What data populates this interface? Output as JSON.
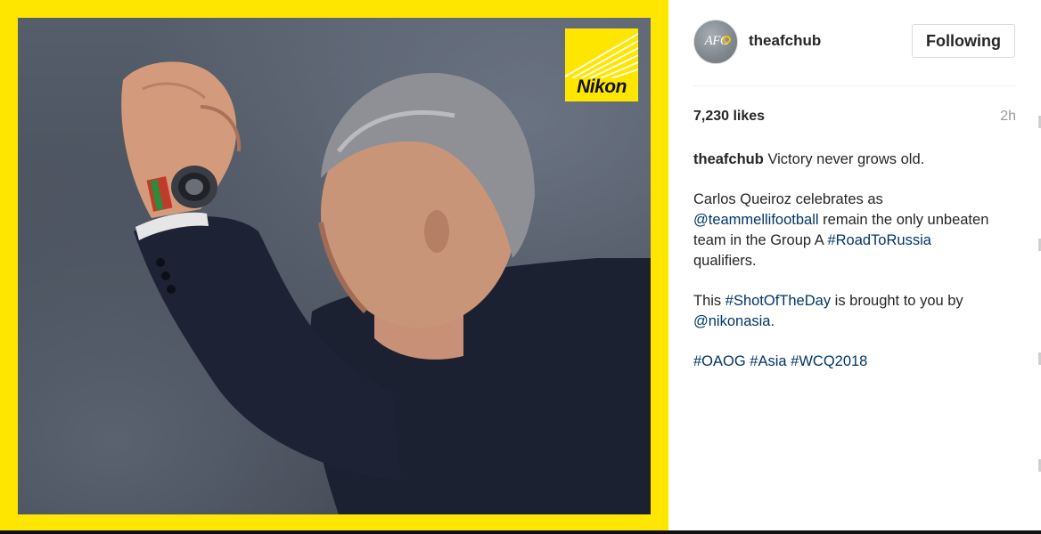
{
  "brand_logo": {
    "text": "Nikon"
  },
  "post": {
    "username": "theafchub",
    "avatar_text": "AFC",
    "follow_label": "Following",
    "likes": "7,230 likes",
    "time_ago": "2h"
  },
  "caption": {
    "username": "theafchub",
    "line1_text": "Victory never grows old.",
    "p2_a": "Carlos Queiroz celebrates as",
    "p2_mention": "@teammellifootball",
    "p2_b": "remain the only unbeaten team in the Group A",
    "p2_hashtag": "#RoadToRussia",
    "p2_c": "qualifiers.",
    "p3_a": "This",
    "p3_hashtag": "#ShotOfTheDay",
    "p3_b": "is brought to you by",
    "p3_mention": "@nikonasia",
    "p3_c": ".",
    "tag_1": "#OAOG",
    "tag_2": "#Asia",
    "tag_3": "#WCQ2018"
  },
  "colors": {
    "frame_yellow": "#ffe600",
    "link_blue": "#003569",
    "text": "#262626",
    "muted": "#999999"
  }
}
